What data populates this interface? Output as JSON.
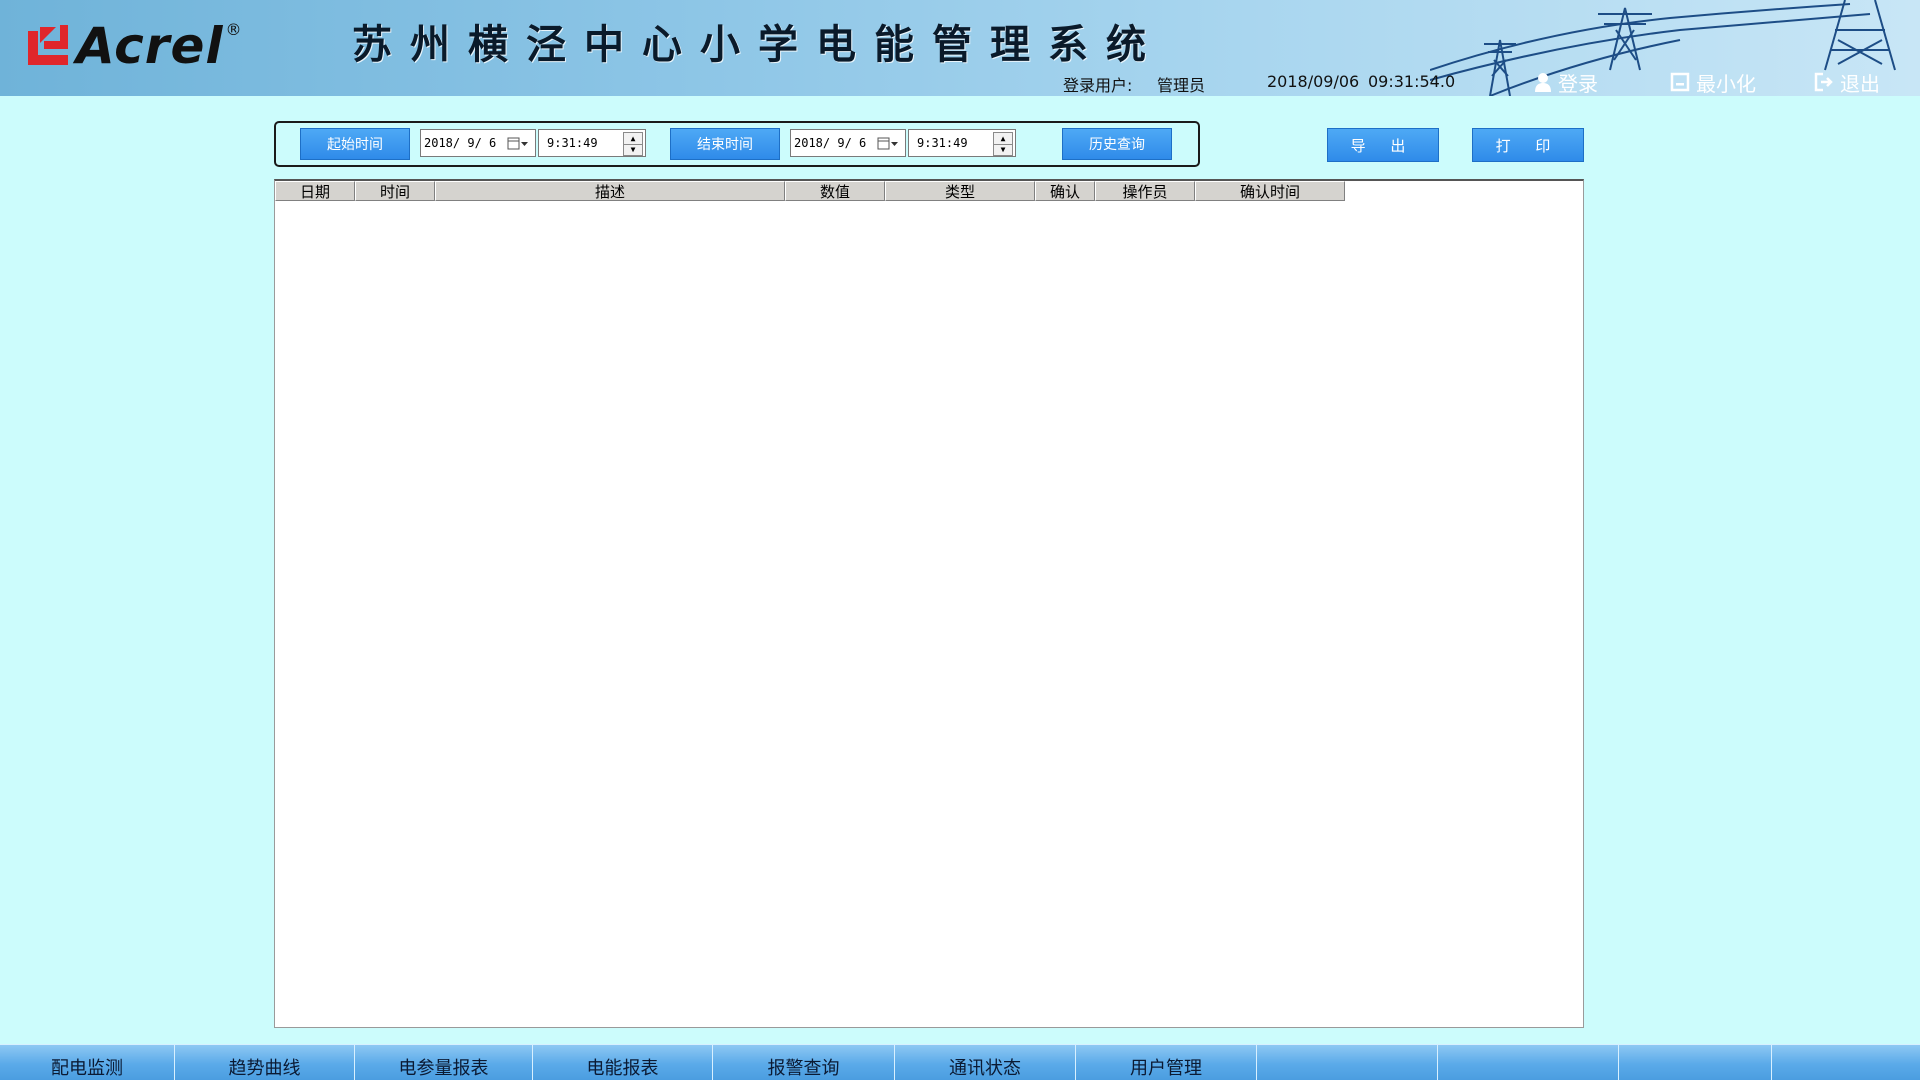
{
  "header": {
    "logo_text": "Acrel",
    "logo_reg": "®",
    "title": "苏州横泾中心小学电能管理系统",
    "user_label": "登录用户:",
    "user_name": "管理员",
    "date": "2018/09/06",
    "time": "09:31:54.0",
    "buttons": {
      "login": "登录",
      "minimize": "最小化",
      "exit": "退出"
    }
  },
  "query": {
    "start_label": "起始时间",
    "start_date": "2018/ 9/ 6",
    "start_time": "9:31:49",
    "end_label": "结束时间",
    "end_date": "2018/ 9/ 6",
    "end_time": "9:31:49",
    "history_label": "历史查询"
  },
  "actions": {
    "export": "导 出",
    "print": "打 印"
  },
  "table": {
    "columns": [
      "日期",
      "时间",
      "描述",
      "数值",
      "类型",
      "确认",
      "操作员",
      "确认时间"
    ],
    "rows": []
  },
  "nav": {
    "tabs": [
      "配电监测",
      "趋势曲线",
      "电参量报表",
      "电能报表",
      "报警查询",
      "通讯状态",
      "用户管理",
      "",
      "",
      "",
      ""
    ]
  },
  "colors": {
    "background": "#ccfcfc",
    "button_blue": "#2f8be9",
    "logo_red": "#e0262b"
  }
}
